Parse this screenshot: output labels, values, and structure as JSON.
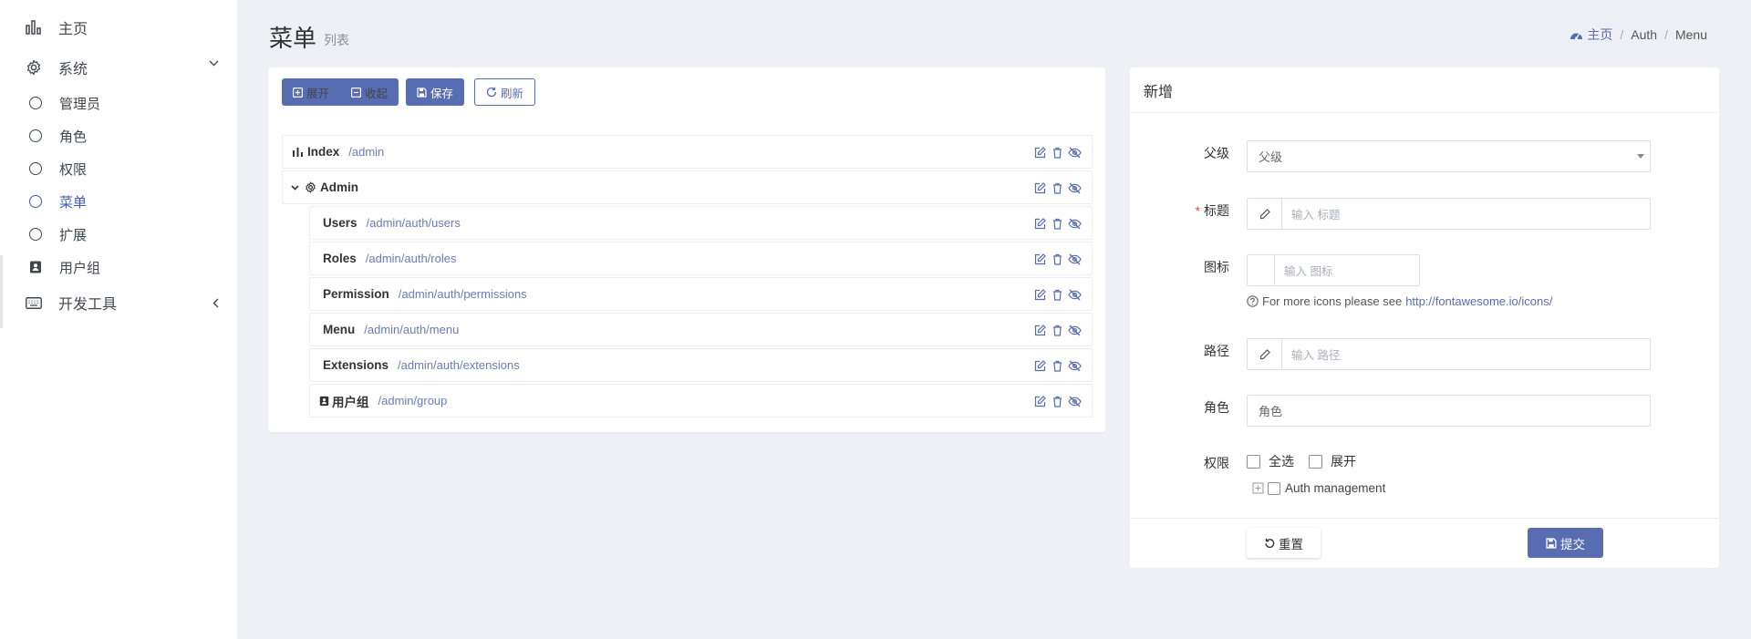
{
  "sidebar": {
    "home": "主页",
    "system": "系统",
    "sub_items": [
      "管理员",
      "角色",
      "权限",
      "菜单",
      "扩展"
    ],
    "usergroup": "用户组",
    "devtools": "开发工具"
  },
  "header": {
    "title": "菜单",
    "subtitle": "列表",
    "breadcrumb": [
      "主页",
      "Auth",
      "Menu"
    ]
  },
  "toolbar": {
    "expand": "展开",
    "collapse": "收起",
    "save": "保存",
    "refresh": "刷新"
  },
  "tree": [
    {
      "title": "Index",
      "path": "/admin"
    },
    {
      "title": "Admin",
      "path": ""
    },
    {
      "title": "Users",
      "path": "/admin/auth/users"
    },
    {
      "title": "Roles",
      "path": "/admin/auth/roles"
    },
    {
      "title": "Permission",
      "path": "/admin/auth/permissions"
    },
    {
      "title": "Menu",
      "path": "/admin/auth/menu"
    },
    {
      "title": "Extensions",
      "path": "/admin/auth/extensions"
    },
    {
      "title": "用户组",
      "path": "/admin/group"
    }
  ],
  "form": {
    "header": "新增",
    "parent_label": "父级",
    "parent_value": "父级",
    "title_label": "标题",
    "title_placeholder": "输入 标题",
    "icon_label": "图标",
    "icon_placeholder": "输入 图标",
    "icon_help": "For more icons please see",
    "icon_help_link": "http://fontawesome.io/icons/",
    "uri_label": "路径",
    "uri_placeholder": "输入 路径",
    "roles_label": "角色",
    "roles_placeholder": "角色",
    "perm_label": "权限",
    "select_all": "全选",
    "expand": "展开",
    "perm_node": "Auth management",
    "reset": "重置",
    "submit": "提交"
  },
  "colors": {
    "primary": "#586cb1",
    "active": "#3d5bb3",
    "background": "#eff0f6"
  }
}
